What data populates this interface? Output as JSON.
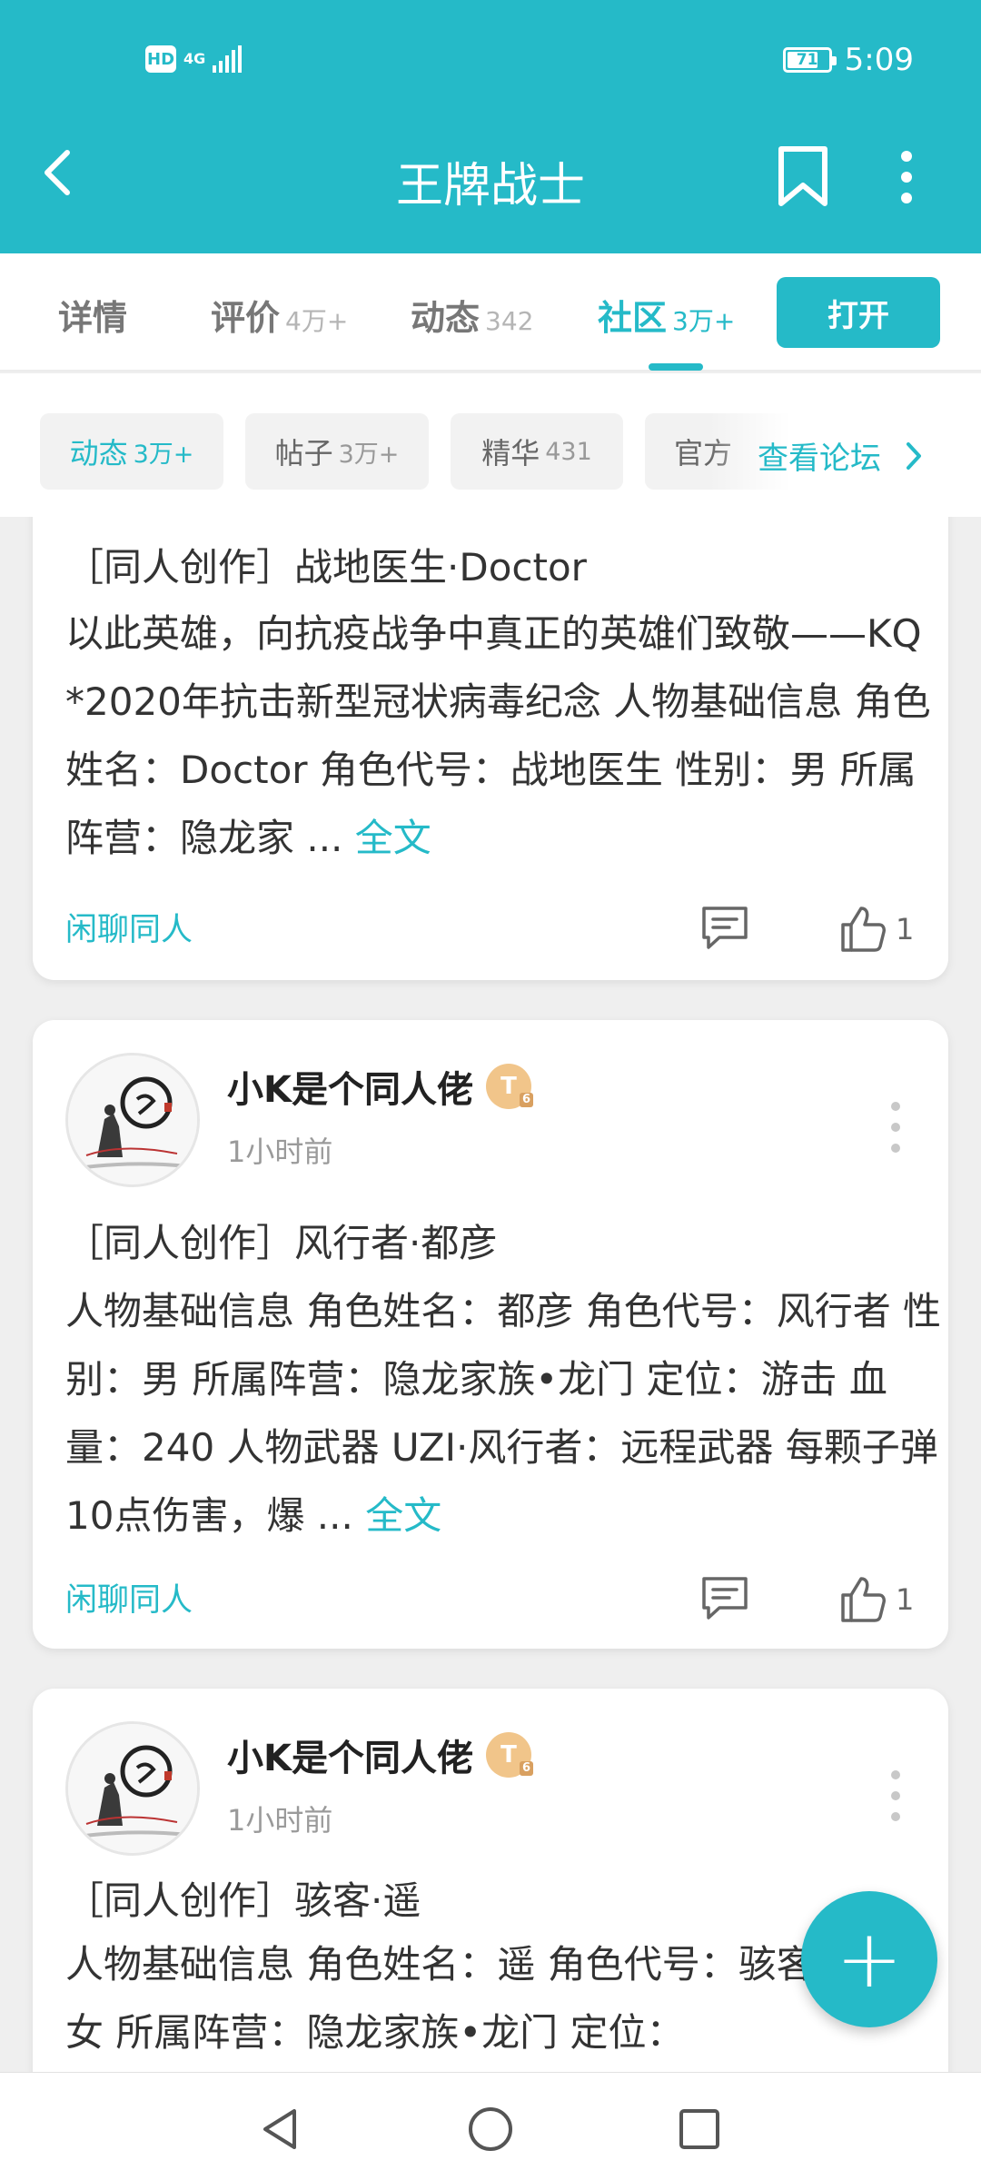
{
  "status_bar": {
    "hd": "HD",
    "network": "4G",
    "battery": "71",
    "time": "5:09"
  },
  "header": {
    "title": "王牌战士"
  },
  "tabs": [
    {
      "label": "详情",
      "count": ""
    },
    {
      "label": "评价",
      "count": "4万+"
    },
    {
      "label": "动态",
      "count": "342"
    },
    {
      "label": "社区",
      "count": "3万+",
      "active": true
    }
  ],
  "open_button": "打开",
  "chips": [
    {
      "label": "动态",
      "count": "3万+",
      "active": true
    },
    {
      "label": "帖子",
      "count": "3万+"
    },
    {
      "label": "精华",
      "count": "431"
    },
    {
      "label": "官方",
      "count": ""
    }
  ],
  "forum_link": "查看论坛",
  "posts": [
    {
      "title": "［同人创作］战地医生·Doctor",
      "body": "以此英雄，向抗疫战争中真正的英雄们致敬——KQ *2020年抗击新型冠状病毒纪念 人物基础信息 角色姓名：Doctor 角色代号：战地医生 性别：男 所属阵营：隐龙家 ...",
      "more": "全文",
      "tag": "闲聊同人",
      "likes": "1"
    },
    {
      "author": "小K是个同人佬",
      "level": "T",
      "time": "1小时前",
      "title": "［同人创作］风行者·都彦",
      "body": "人物基础信息 角色姓名：都彦 角色代号：风行者 性别：男 所属阵营：隐龙家族•龙门 定位：游击 血量：240 人物武器 UZI·风行者：远程武器 每颗子弹10点伤害，爆 ...",
      "more": "全文",
      "tag": "闲聊同人",
      "likes": "1"
    },
    {
      "author": "小K是个同人佬",
      "level": "T",
      "time": "1小时前",
      "title": "［同人创作］骇客·遥",
      "body": "人物基础信息 角色姓名：遥 角色代号：骇客 性别：女 所属阵营：隐龙家族•龙门 定位："
    }
  ],
  "fab": "+",
  "colors": {
    "accent": "#25bac8",
    "background": "#efefef"
  },
  "icons": [
    "back-arrow-icon",
    "bookmark-icon",
    "more-vertical-icon",
    "chevron-right-icon",
    "comment-icon",
    "thumbs-up-icon",
    "avatar-ink-painting",
    "plus-icon",
    "nav-back-icon",
    "nav-home-icon",
    "nav-recents-icon"
  ]
}
